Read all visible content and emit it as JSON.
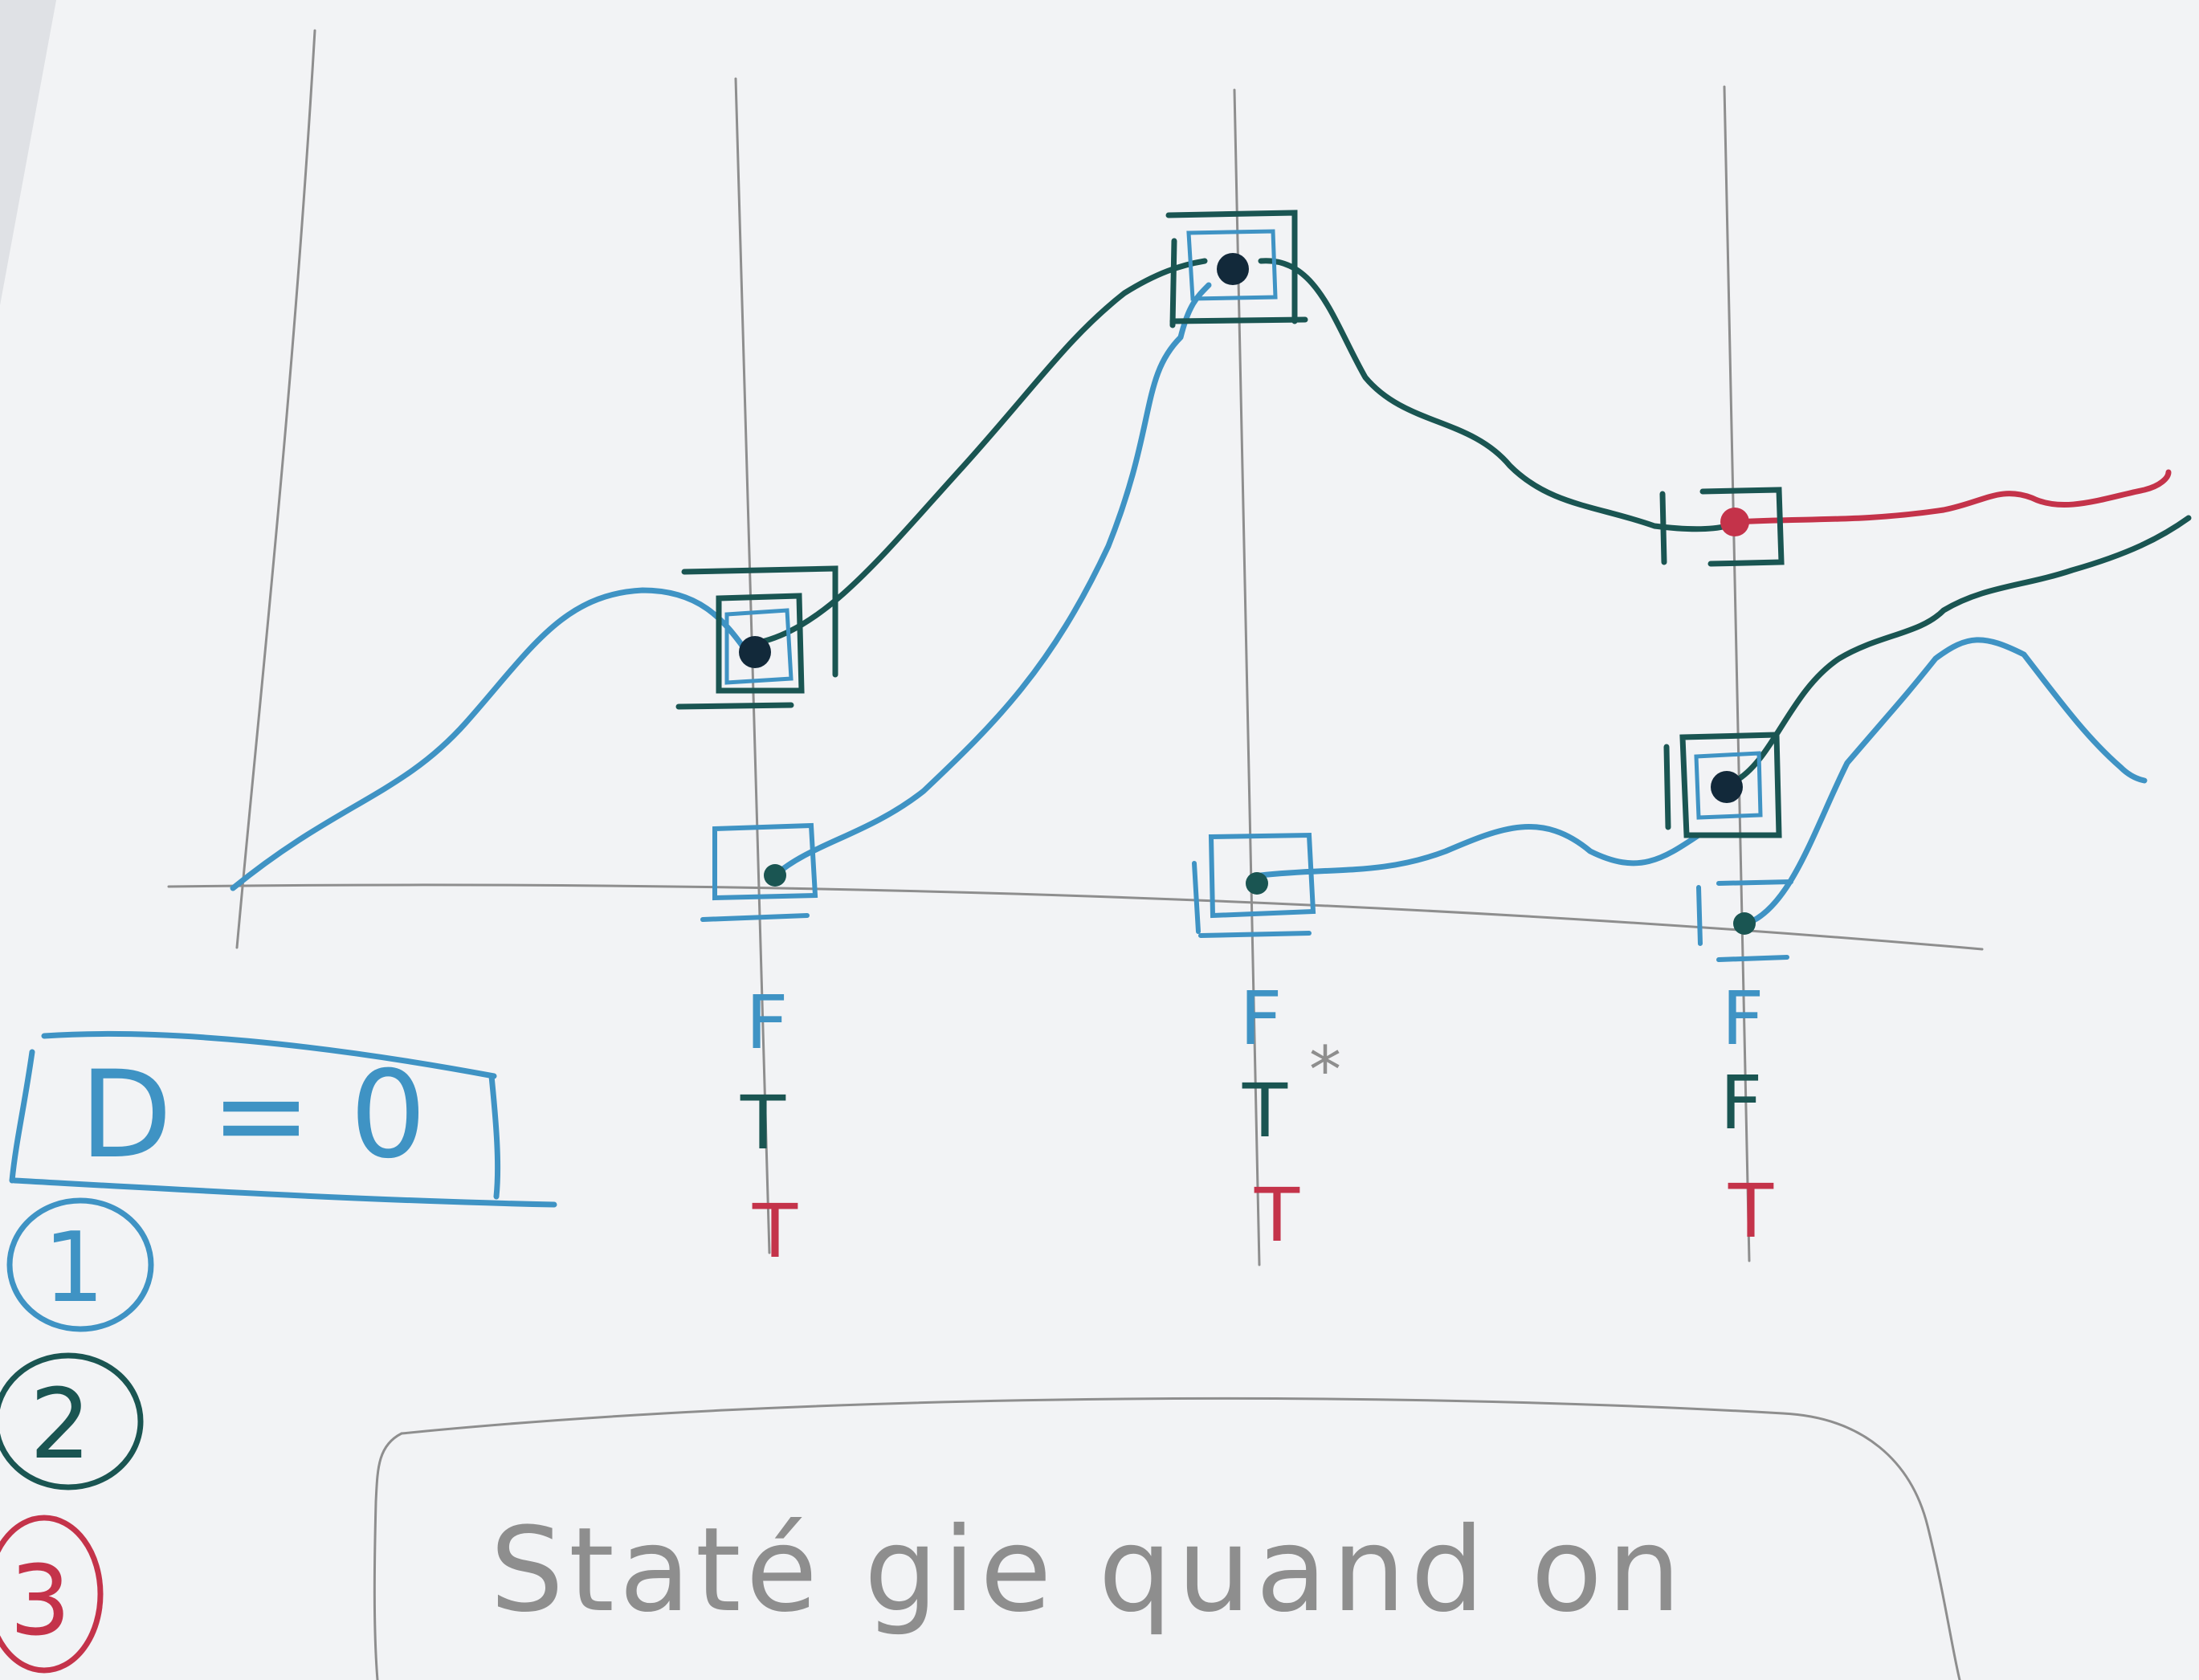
{
  "sheet": {
    "paper_color": "#f2f3f5",
    "shadow_color": "#dfe1e5"
  },
  "ink": {
    "blue": "#3f93c4",
    "green": "#1a5552",
    "red": "#c4334a",
    "dark": "#12293a",
    "pencil": "#8e8e8e"
  },
  "legend": {
    "title": "D = 0",
    "items": [
      {
        "number": "1",
        "color": "blue"
      },
      {
        "number": "2",
        "color": "green"
      },
      {
        "number": "3",
        "color": "red"
      }
    ]
  },
  "columns": [
    {
      "blue": "F",
      "green": "T",
      "red": "T"
    },
    {
      "blue": "F",
      "green": "T",
      "red": "T",
      "star": "*"
    },
    {
      "blue": "F",
      "green": "F",
      "red": "T"
    }
  ],
  "note": {
    "text": "Staté gie quand on"
  }
}
